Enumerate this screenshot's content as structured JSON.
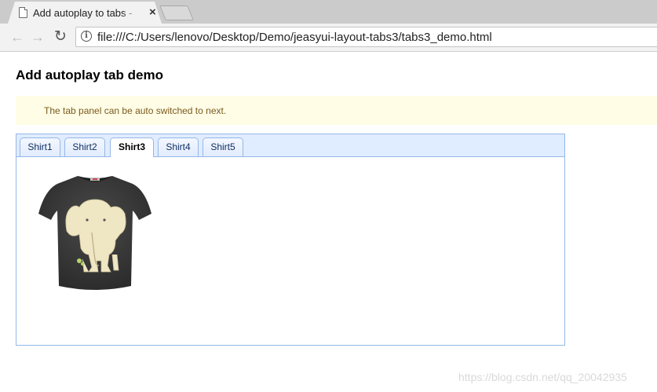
{
  "browser": {
    "tab_title": "Add autoplay to tabs - ",
    "tab_close": "×",
    "nav_back": "←",
    "nav_forward": "→",
    "nav_reload": "↻",
    "info_glyph": "i",
    "url": "file:///C:/Users/lenovo/Desktop/Demo/jeasyui-layout-tabs3/tabs3_demo.html"
  },
  "page": {
    "heading": "Add autoplay tab demo",
    "info": "The tab panel can be auto switched to next."
  },
  "tabs": {
    "items": [
      {
        "label": "Shirt1"
      },
      {
        "label": "Shirt2"
      },
      {
        "label": "Shirt3"
      },
      {
        "label": "Shirt4"
      },
      {
        "label": "Shirt5"
      }
    ],
    "selected_index": 2
  },
  "watermark": "https://blog.csdn.net/qq_20042935",
  "colors": {
    "tab_header_bg": "#e0ecff",
    "tab_border": "#95b8e7",
    "info_bg": "#fffde6",
    "info_text": "#7a5a1e",
    "shirt": "#3a3a3a",
    "print": "#efe6c4"
  }
}
